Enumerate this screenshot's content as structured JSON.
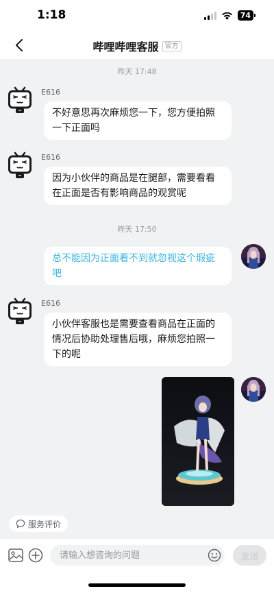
{
  "status": {
    "time": "1:18",
    "battery": "74"
  },
  "nav": {
    "title": "哔哩哔哩客服",
    "tag": "官方"
  },
  "messages": {
    "time1": "昨天 17:48",
    "m1_sender": "E616",
    "m1_text": "不好意思再次麻烦您一下，您方便拍照一下正面吗",
    "m2_sender": "E616",
    "m2_text": "因为小伙伴的商品是在腿部，需要看看在正面是否有影响商品的观赏呢",
    "time2": "昨天 17:50",
    "m3_text": "总不能因为正面看不到就忽视这个瑕疵吧",
    "m4_sender": "E616",
    "m4_text": "小伙伴客服也是需要查看商品在正面的情况后协助处理售后哦，麻烦您拍照一下的呢"
  },
  "service_rating": {
    "label": "服务评价"
  },
  "input": {
    "placeholder": "请输入想咨询的问题",
    "send_label": "发送"
  },
  "colors": {
    "accent_link": "#3bb4dc",
    "background": "#f1f2f3"
  },
  "icons": [
    "back-arrow-icon",
    "bilibili-tv-avatar-icon",
    "comment-icon",
    "image-icon",
    "plus-icon",
    "emoji-icon"
  ]
}
